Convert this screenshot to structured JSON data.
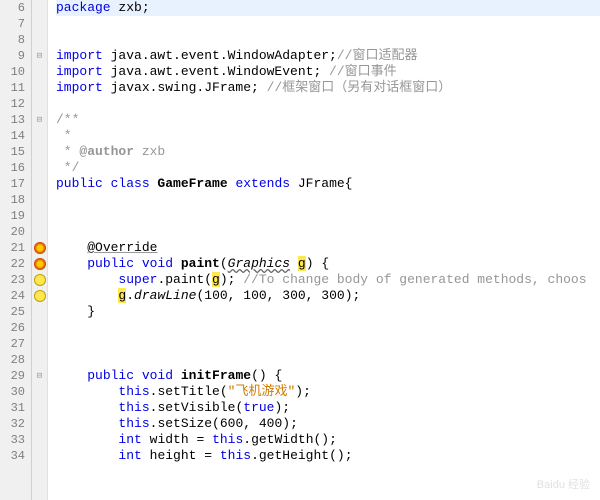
{
  "lines": [
    {
      "n": 6,
      "marker": "",
      "fold": "",
      "tokens": [
        {
          "t": "package ",
          "c": "kw"
        },
        {
          "t": "zxb;",
          "c": ""
        }
      ],
      "hl": true
    },
    {
      "n": 7,
      "marker": "",
      "fold": "",
      "tokens": []
    },
    {
      "n": 8,
      "marker": "",
      "fold": "",
      "tokens": []
    },
    {
      "n": 9,
      "marker": "",
      "fold": "⊟",
      "tokens": [
        {
          "t": "import ",
          "c": "kw"
        },
        {
          "t": "java.awt.event.WindowAdapter;",
          "c": ""
        },
        {
          "t": "//窗口适配器",
          "c": "comment"
        }
      ]
    },
    {
      "n": 10,
      "marker": "",
      "fold": "",
      "tokens": [
        {
          "t": "import ",
          "c": "kw"
        },
        {
          "t": "java.awt.event.WindowEvent; ",
          "c": ""
        },
        {
          "t": "//窗口事件",
          "c": "comment"
        }
      ]
    },
    {
      "n": 11,
      "marker": "",
      "fold": "",
      "tokens": [
        {
          "t": "import ",
          "c": "kw"
        },
        {
          "t": "javax.swing.JFrame; ",
          "c": ""
        },
        {
          "t": "//框架窗口（另有对话框窗口）",
          "c": "comment"
        }
      ]
    },
    {
      "n": 12,
      "marker": "",
      "fold": "",
      "tokens": []
    },
    {
      "n": 13,
      "marker": "",
      "fold": "⊟",
      "tokens": [
        {
          "t": "/**",
          "c": "comment"
        }
      ]
    },
    {
      "n": 14,
      "marker": "",
      "fold": "",
      "tokens": [
        {
          "t": " *",
          "c": "comment"
        }
      ]
    },
    {
      "n": 15,
      "marker": "",
      "fold": "",
      "tokens": [
        {
          "t": " * ",
          "c": "comment"
        },
        {
          "t": "@author",
          "c": "comment bold"
        },
        {
          "t": " zxb",
          "c": "comment"
        }
      ]
    },
    {
      "n": 16,
      "marker": "",
      "fold": "",
      "tokens": [
        {
          "t": " */",
          "c": "comment"
        }
      ]
    },
    {
      "n": 17,
      "marker": "",
      "fold": "",
      "tokens": [
        {
          "t": "public class ",
          "c": "kw"
        },
        {
          "t": "GameFrame",
          "c": "bold"
        },
        {
          "t": " ",
          "c": ""
        },
        {
          "t": "extends ",
          "c": "kw"
        },
        {
          "t": "JFrame{",
          "c": ""
        }
      ]
    },
    {
      "n": 18,
      "marker": "",
      "fold": "",
      "tokens": []
    },
    {
      "n": 19,
      "marker": "",
      "fold": "",
      "tokens": []
    },
    {
      "n": 20,
      "marker": "",
      "fold": "",
      "tokens": []
    },
    {
      "n": 21,
      "marker": "hint",
      "fold": "",
      "tokens": [
        {
          "t": "    ",
          "c": ""
        },
        {
          "t": "@Override",
          "c": "ann"
        }
      ]
    },
    {
      "n": 22,
      "marker": "hint",
      "fold": "⊟",
      "tokens": [
        {
          "t": "    ",
          "c": ""
        },
        {
          "t": "public void ",
          "c": "kw"
        },
        {
          "t": "paint",
          "c": "bold"
        },
        {
          "t": "(",
          "c": ""
        },
        {
          "t": "Graphics",
          "c": "underline-wavy method"
        },
        {
          "t": " ",
          "c": ""
        },
        {
          "t": "g",
          "c": "hl-yellow"
        },
        {
          "t": ") {",
          "c": ""
        }
      ]
    },
    {
      "n": 23,
      "marker": "warn",
      "fold": "",
      "tokens": [
        {
          "t": "        ",
          "c": ""
        },
        {
          "t": "super",
          "c": "kw"
        },
        {
          "t": ".paint(",
          "c": ""
        },
        {
          "t": "g",
          "c": "hl-yellow"
        },
        {
          "t": "); ",
          "c": ""
        },
        {
          "t": "//To change body of generated methods, choos",
          "c": "comment"
        }
      ]
    },
    {
      "n": 24,
      "marker": "warn",
      "fold": "",
      "tokens": [
        {
          "t": "        ",
          "c": ""
        },
        {
          "t": "g",
          "c": "hl-yellow"
        },
        {
          "t": ".",
          "c": ""
        },
        {
          "t": "drawLine",
          "c": "method"
        },
        {
          "t": "(100, 100, 300, 300);",
          "c": ""
        }
      ]
    },
    {
      "n": 25,
      "marker": "",
      "fold": "",
      "tokens": [
        {
          "t": "    }",
          "c": ""
        }
      ]
    },
    {
      "n": 26,
      "marker": "",
      "fold": "",
      "tokens": []
    },
    {
      "n": 27,
      "marker": "",
      "fold": "",
      "tokens": []
    },
    {
      "n": 28,
      "marker": "",
      "fold": "",
      "tokens": []
    },
    {
      "n": 29,
      "marker": "",
      "fold": "⊟",
      "tokens": [
        {
          "t": "    ",
          "c": ""
        },
        {
          "t": "public void ",
          "c": "kw"
        },
        {
          "t": "initFrame",
          "c": "bold"
        },
        {
          "t": "() {",
          "c": ""
        }
      ]
    },
    {
      "n": 30,
      "marker": "",
      "fold": "",
      "tokens": [
        {
          "t": "        ",
          "c": ""
        },
        {
          "t": "this",
          "c": "kw"
        },
        {
          "t": ".setTitle(",
          "c": ""
        },
        {
          "t": "\"飞机游戏\"",
          "c": "str"
        },
        {
          "t": ");",
          "c": ""
        }
      ]
    },
    {
      "n": 31,
      "marker": "",
      "fold": "",
      "tokens": [
        {
          "t": "        ",
          "c": ""
        },
        {
          "t": "this",
          "c": "kw"
        },
        {
          "t": ".setVisible(",
          "c": ""
        },
        {
          "t": "true",
          "c": "kw"
        },
        {
          "t": ");",
          "c": ""
        }
      ]
    },
    {
      "n": 32,
      "marker": "",
      "fold": "",
      "tokens": [
        {
          "t": "        ",
          "c": ""
        },
        {
          "t": "this",
          "c": "kw"
        },
        {
          "t": ".setSize(600, 400);",
          "c": ""
        }
      ]
    },
    {
      "n": 33,
      "marker": "",
      "fold": "",
      "tokens": [
        {
          "t": "        ",
          "c": ""
        },
        {
          "t": "int ",
          "c": "kw"
        },
        {
          "t": "width = ",
          "c": ""
        },
        {
          "t": "this",
          "c": "kw"
        },
        {
          "t": ".getWidth();",
          "c": ""
        }
      ]
    },
    {
      "n": 34,
      "marker": "",
      "fold": "",
      "tokens": [
        {
          "t": "        ",
          "c": ""
        },
        {
          "t": "int ",
          "c": "kw"
        },
        {
          "t": "height = ",
          "c": ""
        },
        {
          "t": "this",
          "c": "kw"
        },
        {
          "t": ".getHeight();",
          "c": ""
        }
      ]
    }
  ],
  "watermark": "Baidu 经验"
}
